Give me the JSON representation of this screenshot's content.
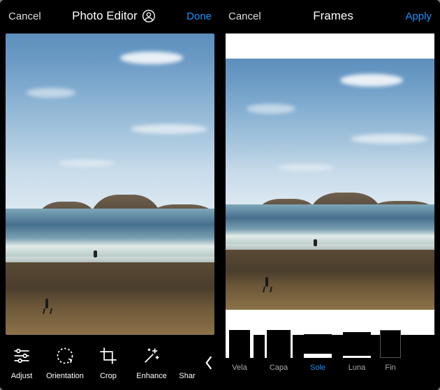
{
  "left": {
    "cancel": "Cancel",
    "title": "Photo Editor",
    "done": "Done",
    "tools": {
      "adjust": "Adjust",
      "orientation": "Orientation",
      "crop": "Crop",
      "enhance": "Enhance",
      "sharpen": "Shar"
    }
  },
  "right": {
    "cancel": "Cancel",
    "title": "Frames",
    "apply": "Apply",
    "frames": {
      "vela": "Vela",
      "capa": "Capa",
      "sole": "Sole",
      "luna": "Luna",
      "fine": "Fin"
    },
    "selected": "sole"
  }
}
